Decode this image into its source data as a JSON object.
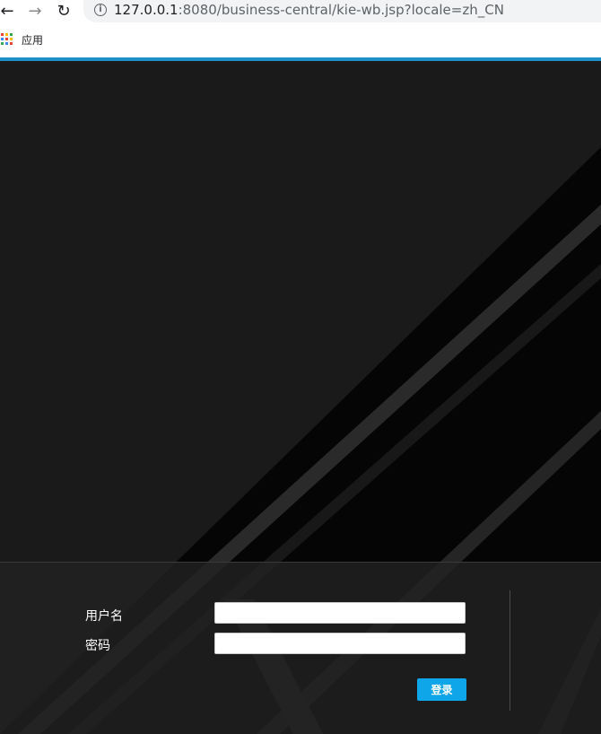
{
  "browser": {
    "url_host": "127.0.0.1",
    "url_rest": ":8080/business-central/kie-wb.jsp?locale=zh_CN",
    "bookmarks": {
      "apps_label": "应用"
    }
  },
  "colors": {
    "accent": "#1f8fc7",
    "login_button": "#0ea5e9",
    "background": "#000000"
  },
  "login": {
    "username_label": "用户名",
    "password_label": "密码",
    "username_value": "",
    "password_value": "",
    "submit_label": "登录"
  }
}
